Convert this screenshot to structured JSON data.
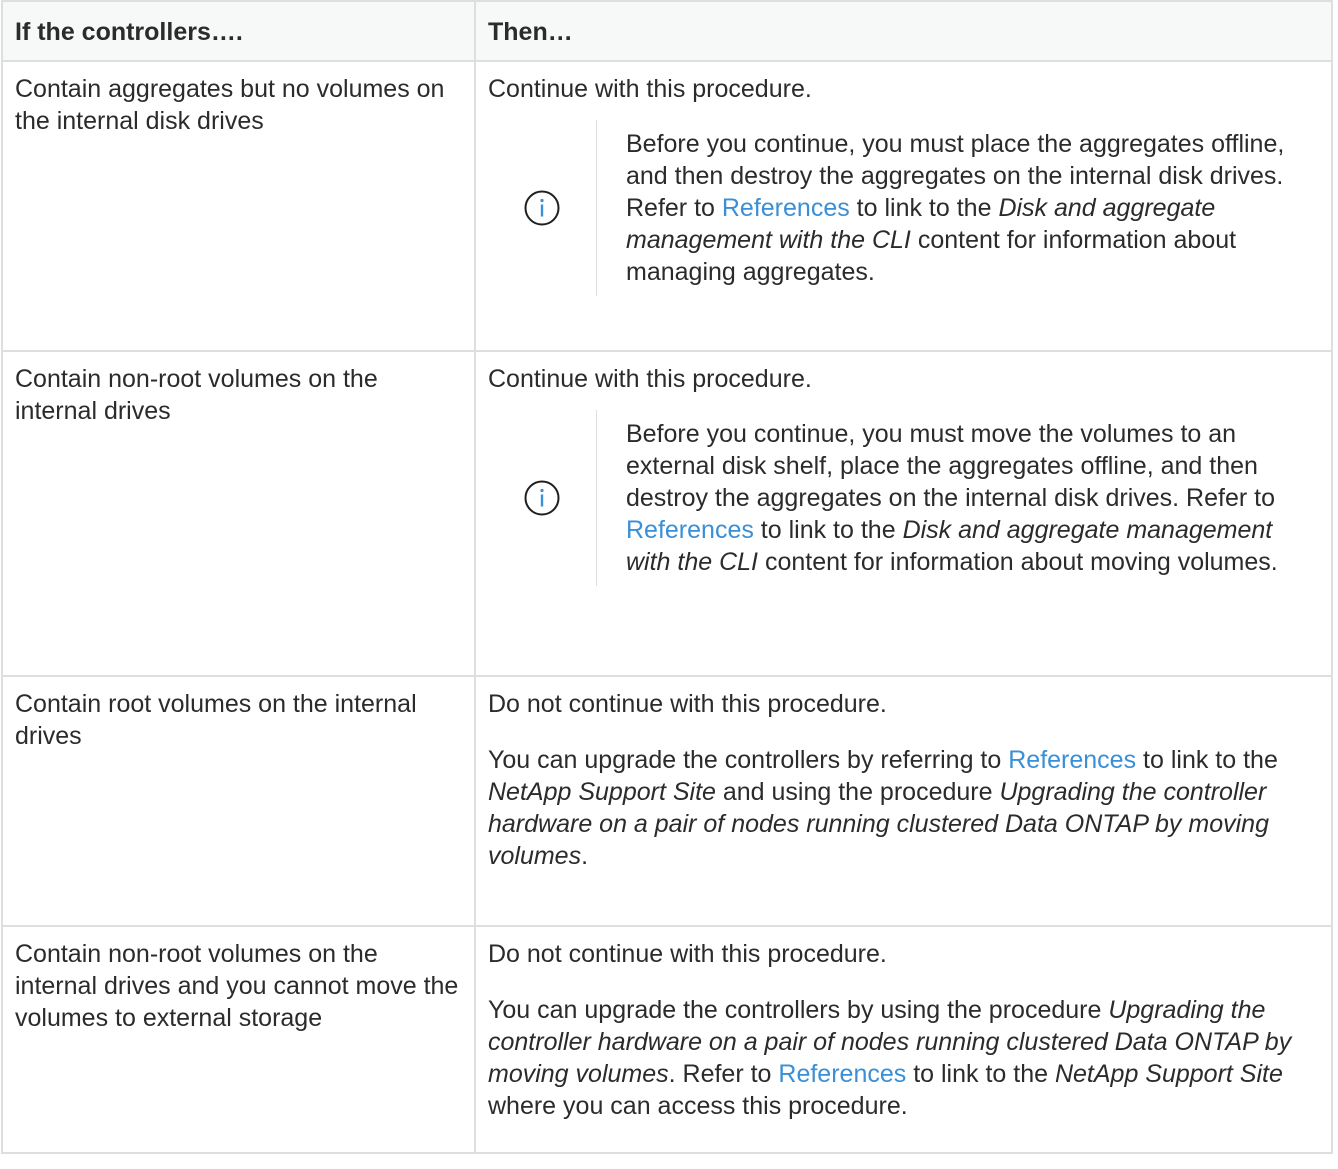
{
  "header": {
    "col1": "If the controllers….",
    "col2": "Then…"
  },
  "rows": [
    {
      "condition": "Contain aggregates but no volumes on the internal disk drives",
      "action": "Continue with this procedure.",
      "note": {
        "icon": "info-circle-icon",
        "t1": "Before you continue, you must place the aggregates offline, and then destroy the aggregates on the internal disk drives. Refer to ",
        "link": "References",
        "t2": " to link to the ",
        "em1": "Disk and aggregate management with the CLI",
        "t3": " content for information about managing aggregates."
      }
    },
    {
      "condition": "Contain non-root volumes on the internal drives",
      "action": "Continue with this procedure.",
      "note": {
        "icon": "info-circle-icon",
        "t1": "Before you continue, you must move the volumes to an external disk shelf, place the aggregates offline, and then destroy the aggregates on the internal disk drives. Refer to ",
        "link": "References",
        "t2": " to link to the ",
        "em1": "Disk and aggregate management with the CLI",
        "t3": " content for information about moving volumes."
      }
    },
    {
      "condition": "Contain root volumes on the internal drives",
      "action": "Do not continue with this procedure.",
      "detail": {
        "t1": "You can upgrade the controllers by referring to ",
        "link": "References",
        "t2": " to link to the ",
        "em1": "NetApp Support Site",
        "t3": " and using the procedure ",
        "em2": "Upgrading the controller hardware on a pair of nodes running clustered Data ONTAP by moving volumes",
        "t4": "."
      }
    },
    {
      "condition": "Contain non-root volumes on the internal drives and you cannot move the volumes to external storage",
      "action": "Do not continue with this procedure.",
      "detail": {
        "t1": "You can upgrade the controllers by using the procedure ",
        "em1": "Upgrading the controller hardware on a pair of nodes running clustered Data ONTAP by moving volumes",
        "t2": ". Refer to ",
        "link": "References",
        "t3": " to link to the ",
        "em2": "NetApp Support Site",
        "t4": " where you can access this procedure."
      }
    }
  ],
  "colors": {
    "link": "#3a8fd6",
    "border": "#dedede",
    "header_bg": "#f7f8f8",
    "text": "#2b2b2b"
  }
}
